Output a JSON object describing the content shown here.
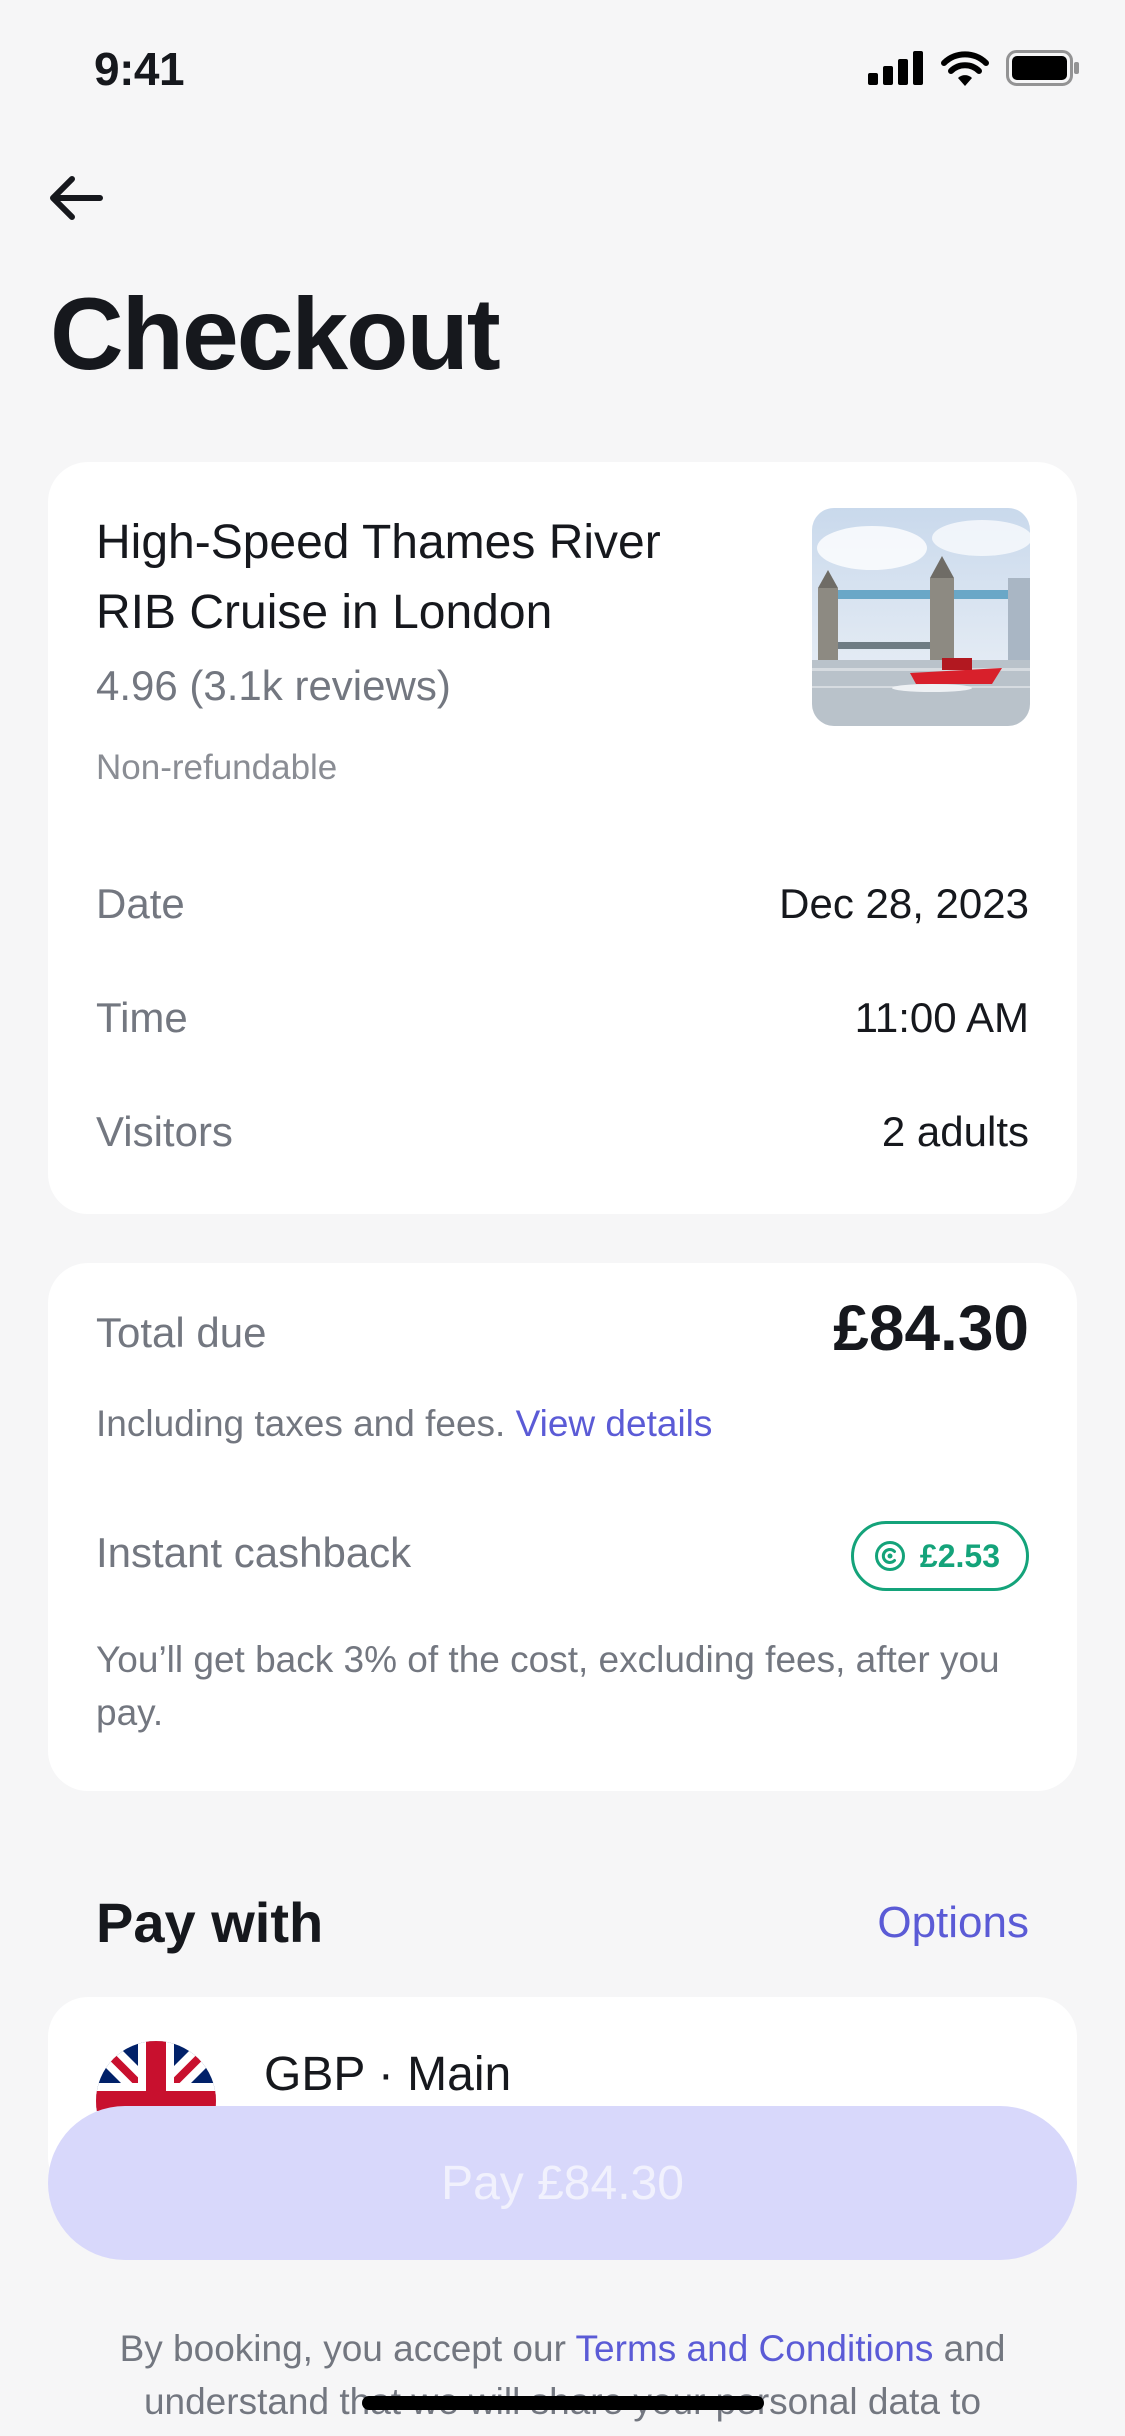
{
  "status_bar": {
    "time": "9:41"
  },
  "header": {
    "title": "Checkout"
  },
  "booking": {
    "tour_name": "High-Speed Thames River RIB Cruise in London",
    "rating": "4.96 (3.1k reviews)",
    "policy": "Non-refundable",
    "details": [
      {
        "label": "Date",
        "value": "Dec 28, 2023"
      },
      {
        "label": "Time",
        "value": "11:00 AM"
      },
      {
        "label": "Visitors",
        "value": "2 adults"
      }
    ]
  },
  "total": {
    "label": "Total due",
    "amount": "£84.30",
    "note": "Including taxes and fees.",
    "details_link": "View details",
    "cashback_label": "Instant cashback",
    "cashback_amount": "£2.53",
    "cashback_note": "You’ll get back 3% of the cost, excluding fees, after you pay."
  },
  "payment": {
    "section_title": "Pay with",
    "options_link": "Options",
    "account_name": "GBP · Main",
    "pay_button": "Pay £84.30"
  },
  "legal": {
    "prefix": "By booking, you accept our",
    "terms_link": "Terms and Conditions",
    "suffix": "and understand that we will share your personal data to"
  },
  "colors": {
    "accent": "#5b5bd6",
    "cashback": "#14a37a",
    "pay_button_bg": "#d8d8fb"
  }
}
